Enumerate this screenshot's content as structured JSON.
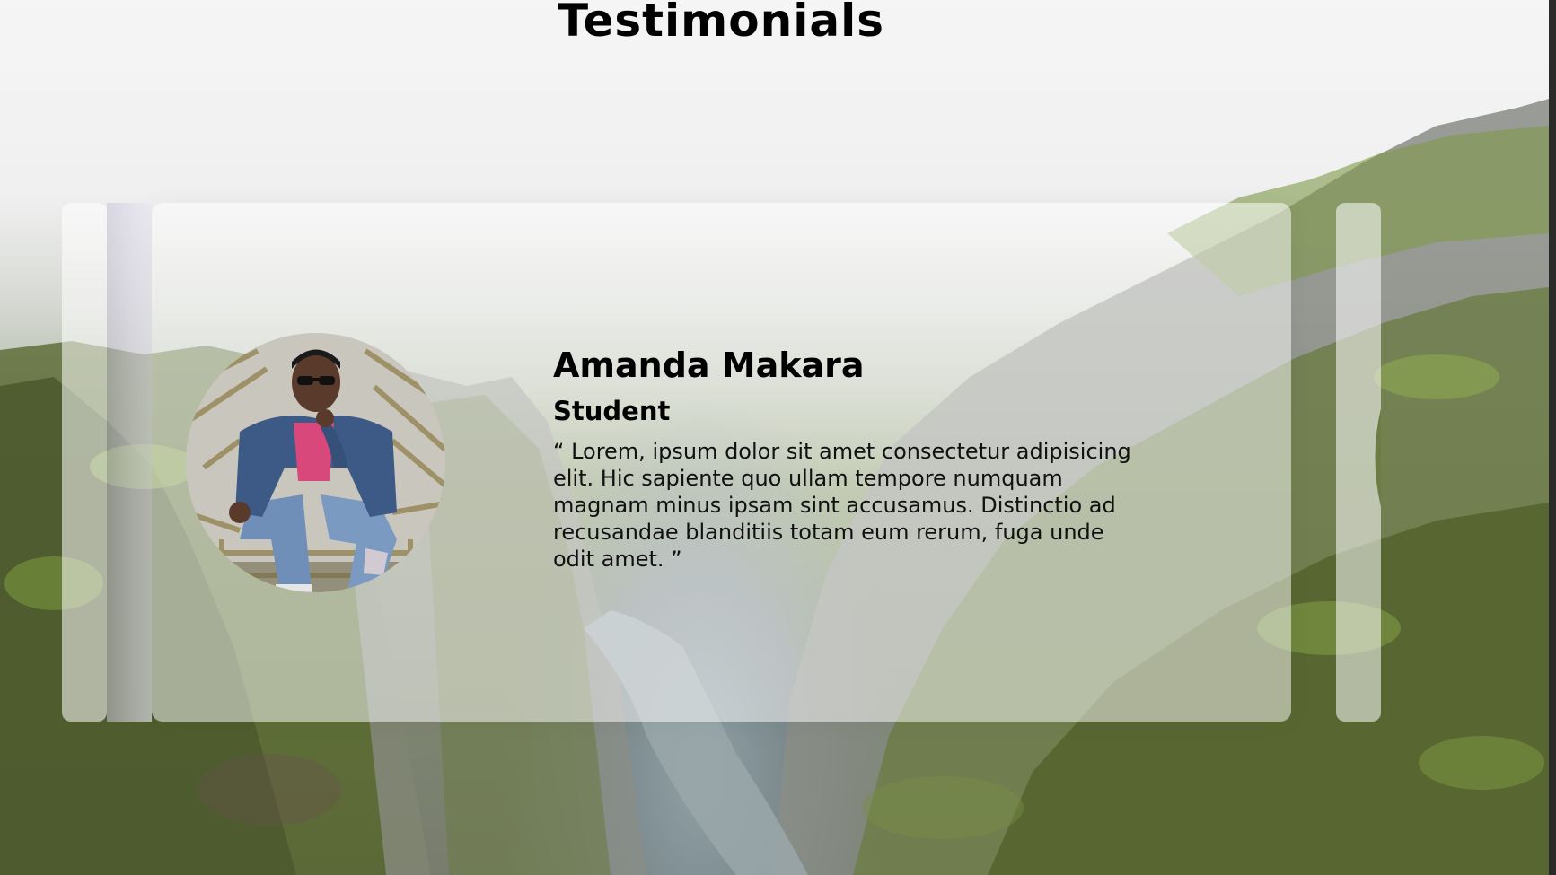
{
  "page": {
    "title": "Testimonials"
  },
  "testimonial": {
    "name": "Amanda Makara",
    "role": "Student",
    "quote": "“ Lorem, ipsum dolor sit amet consectetur adipisicing elit. Hic sapiente quo ullam tempore numquam magnam minus ipsam sint accusamus. Distinctio ad recusandae blanditiis totam eum rerum, fuga unde odit amet. ”",
    "avatar_icon": "person-photo-icon"
  },
  "colors": {
    "title": "#000000",
    "card_overlay": "#ffffff",
    "scrollbar": "#2a2a2a",
    "moss_green": "#6f8a3a",
    "rock_gray": "#8d8f8a",
    "river": "#8fa0a5"
  }
}
